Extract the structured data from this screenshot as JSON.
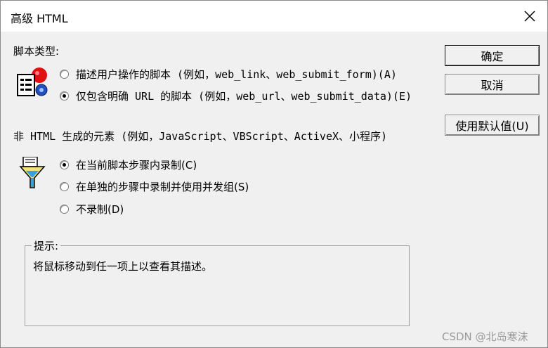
{
  "window": {
    "title": "高级 HTML",
    "close_icon": "close-icon"
  },
  "script_type": {
    "label": "脚本类型:",
    "icon": "script-icon",
    "options": [
      {
        "label": "描述用户操作的脚本 (例如，web_link、web_submit_form)(A)",
        "selected": false
      },
      {
        "label": "仅包含明确 URL 的脚本 (例如，web_url、web_submit_data)(E)",
        "selected": true
      }
    ]
  },
  "non_html": {
    "label": "非 HTML 生成的元素 (例如，JavaScript、VBScript、ActiveX、小程序)",
    "icon": "filter-funnel-icon",
    "options": [
      {
        "label": "在当前脚本步骤内录制(C)",
        "selected": true
      },
      {
        "label": "在单独的步骤中录制并使用并发组(S)",
        "selected": false
      },
      {
        "label": "不录制(D)",
        "selected": false
      }
    ]
  },
  "buttons": {
    "ok": "确定",
    "cancel": "取消",
    "use_defaults": "使用默认值(U)"
  },
  "hint": {
    "legend": "提示:",
    "text": "将鼠标移动到任一项上以查看其描述。"
  },
  "watermark": "CSDN @北岛寒沫"
}
